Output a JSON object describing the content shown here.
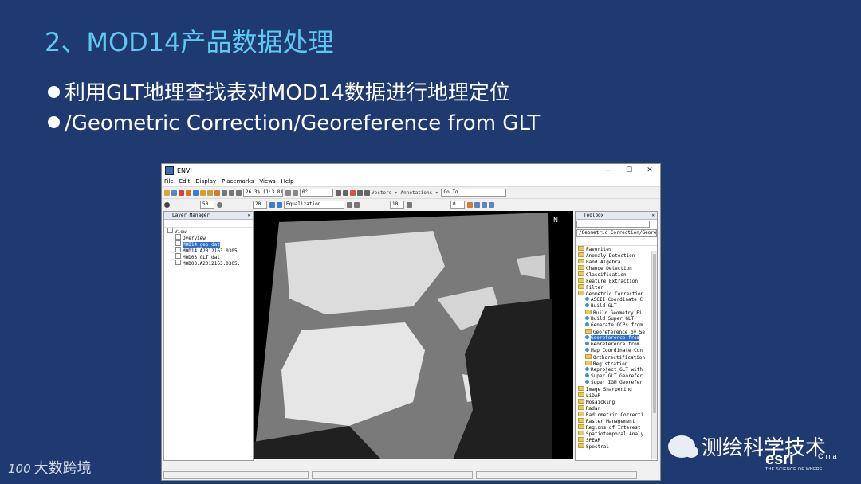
{
  "slide": {
    "title": "2、MOD14产品数据处理",
    "bullets": [
      "利用GLT地理查找表对MOD14数据进行地理定位",
      "/Geometric Correction/Georeference from GLT"
    ]
  },
  "envi": {
    "window_title": "ENVI",
    "controls": {
      "minimize": "—",
      "maximize": "☐",
      "close": "✕"
    },
    "menu": [
      "File",
      "Edit",
      "Display",
      "Placemarks",
      "Views",
      "Help"
    ],
    "toolbar1": {
      "zoom_value": "26.3% (1:3.8)",
      "rotate_value": "0°",
      "vectors_label": "Vectors ▾",
      "annotations_label": "Annotations ▾",
      "goto_placeholder": "Go To"
    },
    "toolbar2": {
      "brightness": "50",
      "contrast": "20",
      "stretch": "Equalization",
      "sharpen": "10",
      "transparency": "0"
    },
    "layer_manager": {
      "title": "Layer Manager",
      "items": [
        {
          "label": "View",
          "level": 0
        },
        {
          "label": "Overview",
          "level": 1
        },
        {
          "label": "MOD14_geo.dat",
          "level": 1,
          "selected": true
        },
        {
          "label": "MOD14.A2012163.0305.",
          "level": 1
        },
        {
          "label": "MOD03_GLT.dat",
          "level": 1
        },
        {
          "label": "MOD03.A2012163.0305.",
          "level": 1
        }
      ]
    },
    "toolbox": {
      "title": "Toolbox",
      "search_value": "/Geometric Correction/Georeference",
      "items": [
        {
          "label": "Favorites",
          "level": 0,
          "kind": "folder"
        },
        {
          "label": "Anomaly Detection",
          "level": 0,
          "kind": "folder"
        },
        {
          "label": "Band Algebra",
          "level": 0,
          "kind": "folder"
        },
        {
          "label": "Change Detection",
          "level": 0,
          "kind": "folder"
        },
        {
          "label": "Classification",
          "level": 0,
          "kind": "folder"
        },
        {
          "label": "Feature Extraction",
          "level": 0,
          "kind": "folder"
        },
        {
          "label": "Filter",
          "level": 0,
          "kind": "folder"
        },
        {
          "label": "Geometric Correction",
          "level": 0,
          "kind": "folder"
        },
        {
          "label": "ASCII Coordinate C",
          "level": 1,
          "kind": "tool"
        },
        {
          "label": "Build GLT",
          "level": 1,
          "kind": "tool"
        },
        {
          "label": "Build Geometry Fi",
          "level": 1,
          "kind": "folder"
        },
        {
          "label": "Build Super GLT",
          "level": 1,
          "kind": "tool"
        },
        {
          "label": "Generate GCPs from",
          "level": 1,
          "kind": "tool"
        },
        {
          "label": "Georeference by Se",
          "level": 1,
          "kind": "folder"
        },
        {
          "label": "Georeference from",
          "level": 1,
          "kind": "tool",
          "selected": true
        },
        {
          "label": "Georeference from",
          "level": 1,
          "kind": "tool"
        },
        {
          "label": "Map Coordinate Con",
          "level": 1,
          "kind": "tool"
        },
        {
          "label": "Orthorectification",
          "level": 1,
          "kind": "folder"
        },
        {
          "label": "Registration",
          "level": 1,
          "kind": "folder"
        },
        {
          "label": "Reproject GLT with",
          "level": 1,
          "kind": "tool"
        },
        {
          "label": "Super GLT Georefer",
          "level": 1,
          "kind": "tool"
        },
        {
          "label": "Super IGM Georefer",
          "level": 1,
          "kind": "tool"
        },
        {
          "label": "Image Sharpening",
          "level": 0,
          "kind": "folder"
        },
        {
          "label": "LiDAR",
          "level": 0,
          "kind": "folder"
        },
        {
          "label": "Mosaicking",
          "level": 0,
          "kind": "folder"
        },
        {
          "label": "Radar",
          "level": 0,
          "kind": "folder"
        },
        {
          "label": "Radiometric Correcti",
          "level": 0,
          "kind": "folder"
        },
        {
          "label": "Raster Management",
          "level": 0,
          "kind": "folder"
        },
        {
          "label": "Regions of Interest",
          "level": 0,
          "kind": "folder"
        },
        {
          "label": "Spatiotemporal Analy",
          "level": 0,
          "kind": "folder"
        },
        {
          "label": "SPEAR",
          "level": 0,
          "kind": "folder"
        },
        {
          "label": "Spectral",
          "level": 0,
          "kind": "folder"
        }
      ]
    },
    "north_arrow": "N"
  },
  "branding": {
    "left_logo_mark": "100",
    "left_logo_text": "大数跨境",
    "wechat_account": "测绘科学技术",
    "esri_text": "esri",
    "esri_tagline": "THE SCIENCE OF WHERE",
    "esri_region": "China"
  }
}
